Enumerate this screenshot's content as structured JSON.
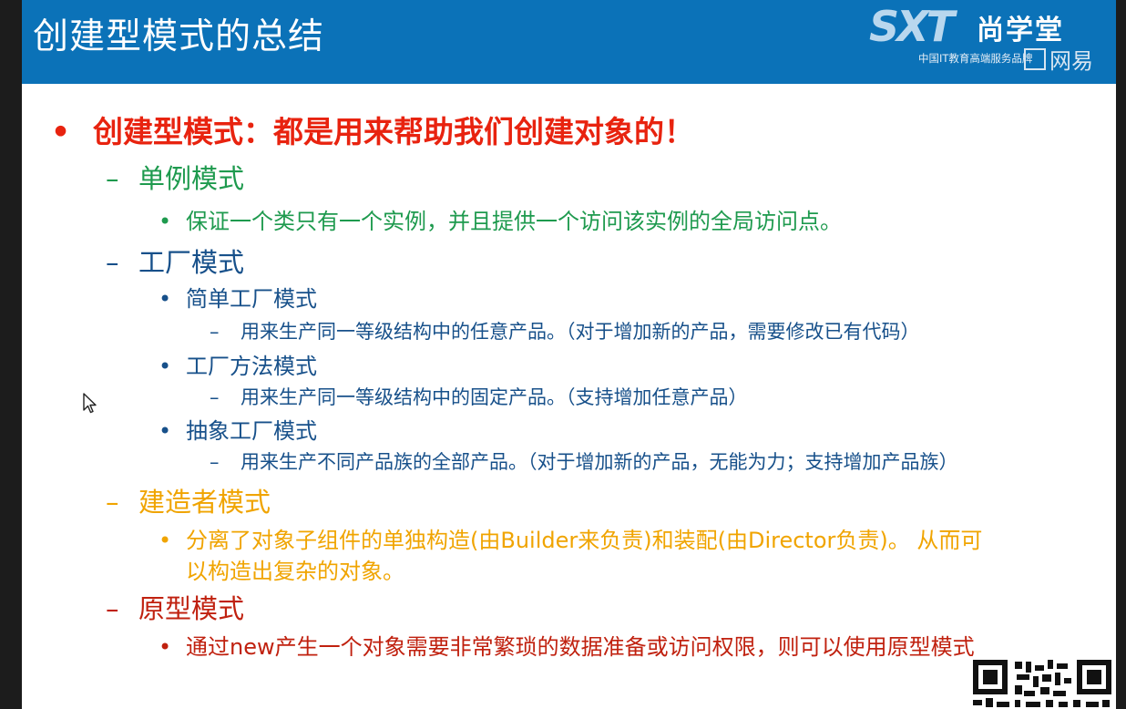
{
  "header": {
    "title": "创建型模式的总结",
    "logo_mark": "SXT",
    "logo_name": "尚学堂",
    "logo_tagline": "中国IT教育高端服务品牌",
    "watermark": "网易"
  },
  "colors": {
    "header_bg": "#0b72b8",
    "main_point": "#e8230f",
    "singleton": "#1e9a4e",
    "factory": "#17508a",
    "builder": "#f0a400",
    "prototype": "#c0210f"
  },
  "content": {
    "main_bullet": "•",
    "main_text": "创建型模式：都是用来帮助我们创建对象的！",
    "singleton_dash": "–",
    "singleton_title": "单例模式",
    "singleton_bullet": "•",
    "singleton_desc": "保证一个类只有一个实例，并且提供一个访问该实例的全局访问点。",
    "factory_dash": "–",
    "factory_title": "工厂模式",
    "simple_bullet": "•",
    "simple_title": "简单工厂模式",
    "simple_dash": "–",
    "simple_desc": "用来生产同一等级结构中的任意产品。（对于增加新的产品，需要修改已有代码）",
    "method_bullet": "•",
    "method_title": "工厂方法模式",
    "method_dash": "–",
    "method_desc": "用来生产同一等级结构中的固定产品。（支持增加任意产品）",
    "abstract_bullet": "•",
    "abstract_title": "抽象工厂模式",
    "abstract_dash": "–",
    "abstract_desc": "用来生产不同产品族的全部产品。（对于增加新的产品，无能为力；支持增加产品族）",
    "builder_dash": "–",
    "builder_title": "建造者模式",
    "builder_bullet": "•",
    "builder_desc_1": "分离了对象子组件的单独构造(由Builder来负责)和装配(由Director负责)。 从而可",
    "builder_desc_2": "以构造出复杂的对象。",
    "prototype_dash": "–",
    "prototype_title": "原型模式",
    "prototype_bullet": "•",
    "prototype_desc": "通过new产生一个对象需要非常繁琐的数据准备或访问权限，则可以使用原型模式"
  }
}
